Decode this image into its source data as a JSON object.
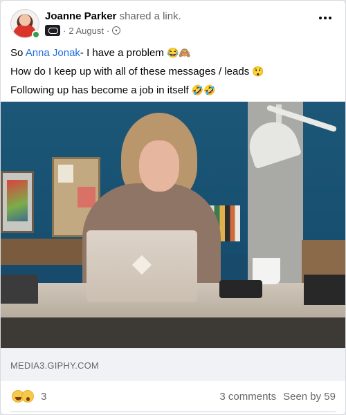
{
  "post": {
    "author": "Joanne Parker",
    "action": "shared a link.",
    "date": "2 August",
    "dot": "·",
    "menu_icon": "more-horizontal-icon",
    "lines": [
      {
        "before": "So ",
        "mention": "Anna Jonak",
        "after": "- I have a problem",
        "emoji": "😂🙈"
      },
      {
        "before": "How do I keep up with all of these messages / leads",
        "emoji": "😲"
      },
      {
        "before": "Following up has become a job in itself",
        "emoji": "🤣🤣"
      }
    ]
  },
  "link": {
    "domain": "MEDIA3.GIPHY.COM"
  },
  "footer": {
    "reaction_icons": [
      "laugh-icon",
      "wow-icon"
    ],
    "reaction_count": "3",
    "comments": "3 comments",
    "seen": "Seen by 59"
  },
  "colors": {
    "mention": "#216fdb",
    "secondary_text": "#65676b",
    "online": "#31a24c"
  }
}
